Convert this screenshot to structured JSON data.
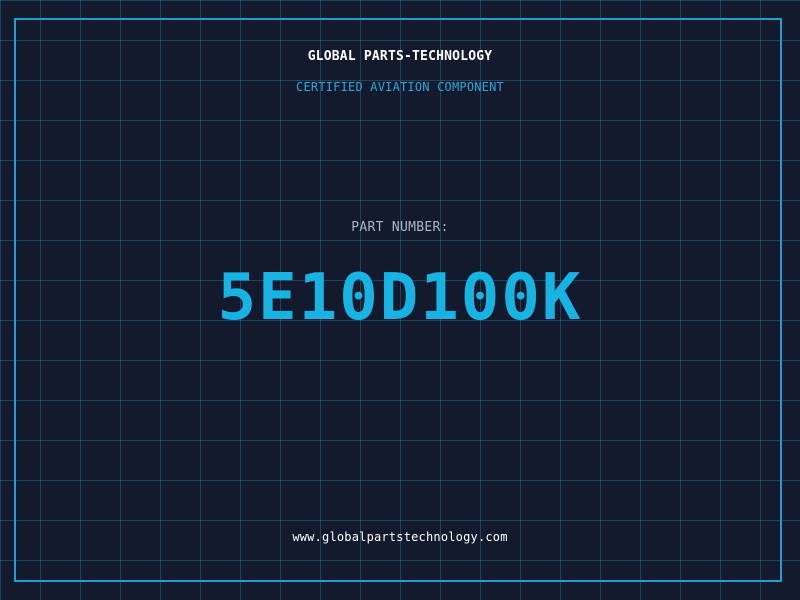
{
  "header": {
    "company": "GLOBAL PARTS-TECHNOLOGY",
    "tagline": "CERTIFIED AVIATION COMPONENT"
  },
  "part": {
    "label": "PART NUMBER:",
    "number": "5E10D100K"
  },
  "footer": {
    "website": "www.globalpartstechnology.com"
  },
  "colors": {
    "background": "#131a2e",
    "grid": "#1a8caa",
    "accent": "#17b4e3",
    "border": "#1f9fcf"
  }
}
